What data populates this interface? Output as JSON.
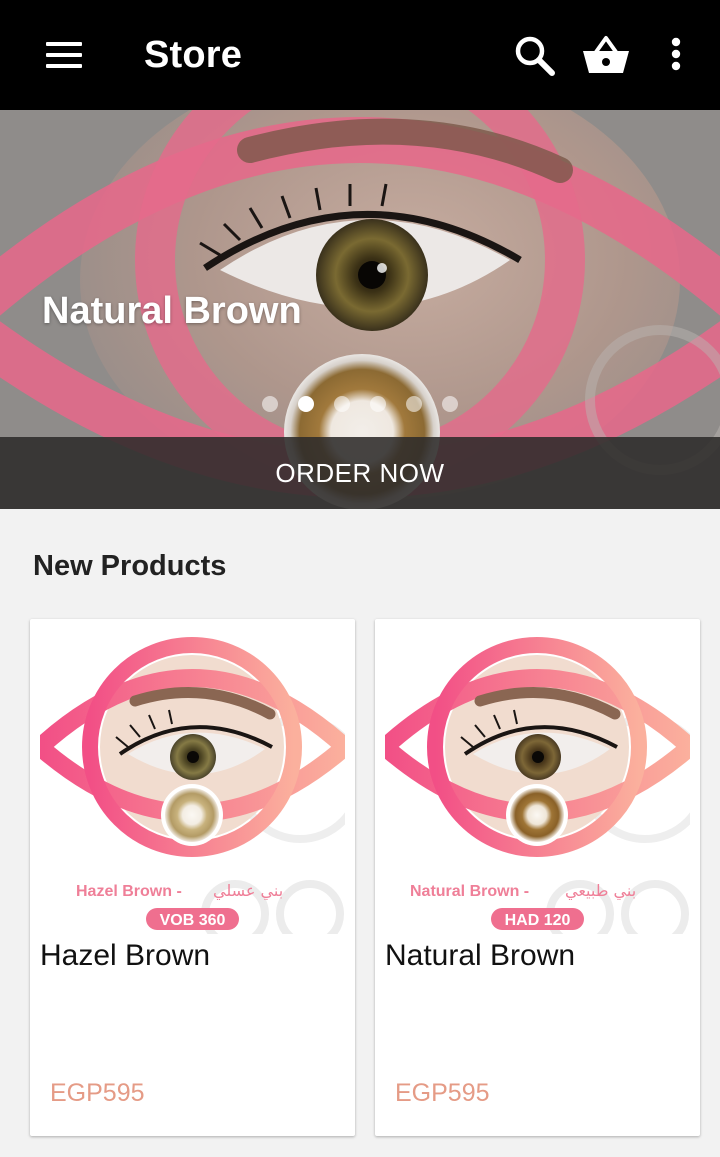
{
  "appbar": {
    "title": "Store",
    "icons": [
      "menu-icon",
      "search-icon",
      "basket-icon",
      "more-vert-icon"
    ]
  },
  "hero": {
    "slide_title": "Natural Brown",
    "slide_count": 6,
    "active_slide": 2,
    "order_label": "ORDER NOW"
  },
  "new_products": {
    "heading": "New Products",
    "items": [
      {
        "name": "Hazel Brown",
        "price": "EGP595",
        "image_caption_en": "Hazel Brown - ",
        "image_caption_ar": "بني عسلي",
        "image_code": "VOB 360"
      },
      {
        "name": "Natural Brown",
        "price": "EGP595",
        "image_caption_en": "Natural Brown - ",
        "image_caption_ar": "بني طبيعي",
        "image_code": "HAD 120"
      }
    ]
  },
  "colors": {
    "appbar": "#000000",
    "accent_pink": "#f36a8f",
    "price": "#e59b86",
    "background": "#f2f2f2"
  }
}
